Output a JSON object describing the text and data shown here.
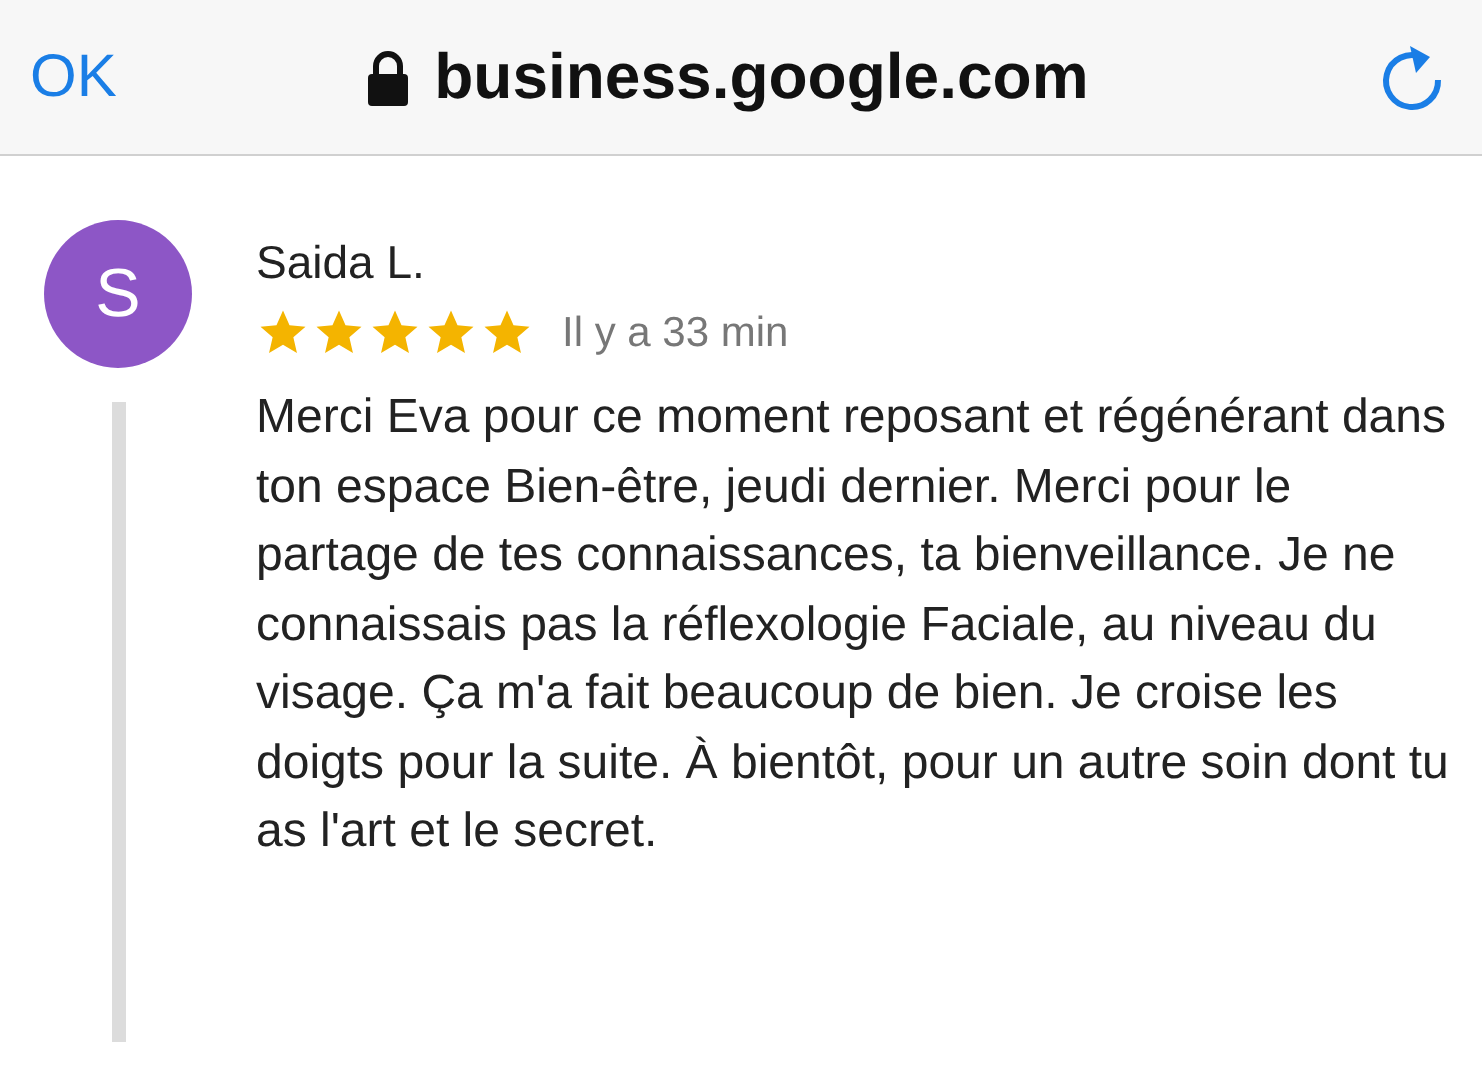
{
  "top_bar": {
    "done_button": "OK",
    "address": "business.google.com"
  },
  "review": {
    "avatar_letter": "S",
    "author": "Saida L.",
    "stars": 5,
    "time": "Il y a 33 min",
    "text": "Merci Eva pour ce moment reposant et régénérant dans ton espace Bien-être, jeudi dernier. Merci pour le partage de tes connaissances, ta bienveillance. Je ne connaissais pas la réflexologie Faciale, au niveau du visage. Ça m'a fait beaucoup de bien. Je croise les doigts pour la suite. À bientôt, pour un autre soin dont tu as l'art et le secret."
  }
}
